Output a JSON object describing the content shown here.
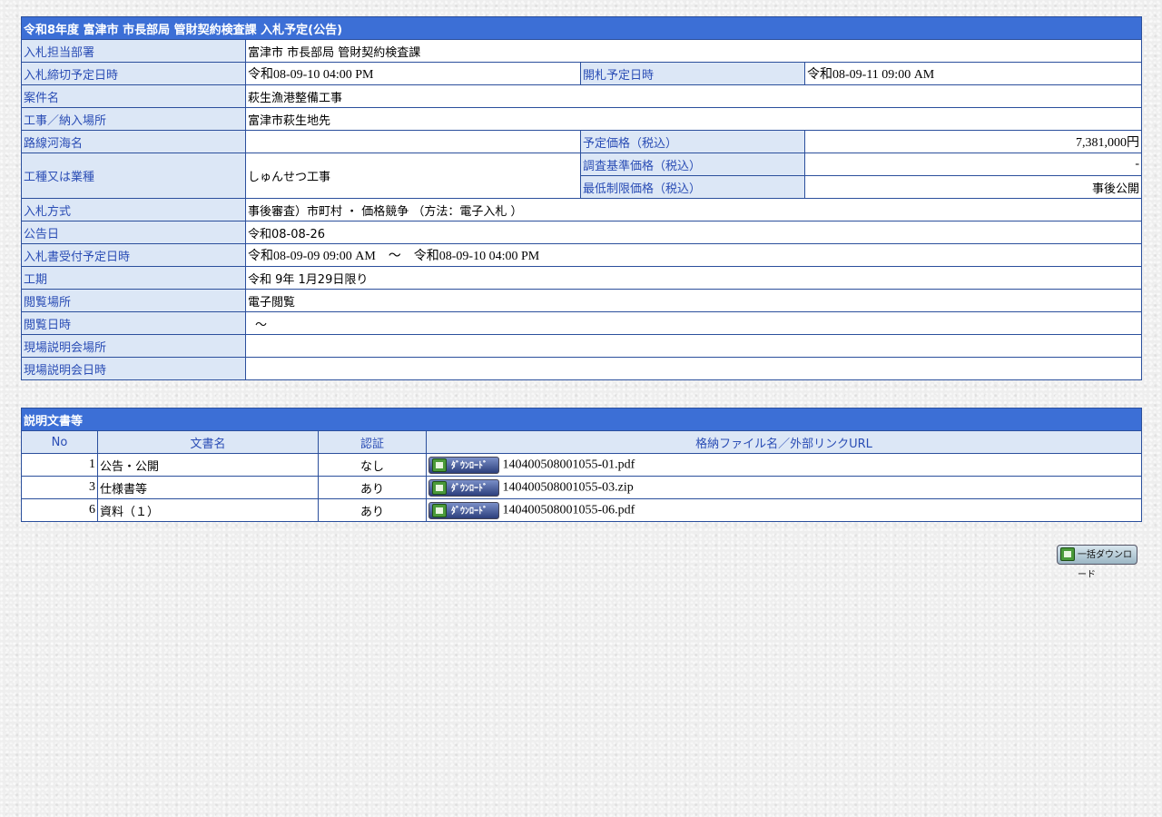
{
  "info": {
    "title": "令和8年度 富津市 市長部局 管財契約検査課 入札予定(公告)",
    "rows": {
      "dept_label": "入札担当部署",
      "dept_value": "富津市 市長部局 管財契約検査課",
      "deadline_label": "入札締切予定日時",
      "deadline_value": "令和08-09-10 04:00 PM",
      "opening_label": "開札予定日時",
      "opening_value": "令和08-09-11 09:00 AM",
      "case_label": "案件名",
      "case_value": "萩生漁港整備工事",
      "place_label": "工事／納入場所",
      "place_value": "富津市萩生地先",
      "route_label": "路線河海名",
      "route_value": "",
      "price_label": "予定価格（税込）",
      "price_value": "7,381,000円",
      "type_label": "工種又は業種",
      "type_value": "しゅんせつ工事",
      "survey_label": "調査基準価格（税込）",
      "survey_value": "-",
      "min_label": "最低制限価格（税込）",
      "min_value": "事後公開",
      "method_label": "入札方式",
      "method_value": "事後審査）市町村 ・ 価格競争 （方法：電子入札 ）",
      "notice_label": "公告日",
      "notice_value": "令和08-08-26",
      "accept_label": "入札書受付予定日時",
      "accept_value": "令和08-09-09 09:00 AM　～　令和08-09-10 04:00 PM",
      "period_label": "工期",
      "period_value": "令和 9年 1月29日限り",
      "view_place_label": "閲覧場所",
      "view_place_value": "電子閲覧",
      "view_date_label": "閲覧日時",
      "view_date_value": "～",
      "site_place_label": "現場説明会場所",
      "site_place_value": "",
      "site_date_label": "現場説明会日時",
      "site_date_value": ""
    }
  },
  "docs": {
    "title": "説明文書等",
    "headers": {
      "no": "No",
      "name": "文書名",
      "auth": "認証",
      "file": "格納ファイル名／外部リンクURL"
    },
    "download_label": "ﾀﾞｳﾝﾛｰﾄﾞ",
    "rows": [
      {
        "no": "1",
        "name": "公告・公開",
        "auth": "なし",
        "file": "140400508001055-01.pdf"
      },
      {
        "no": "3",
        "name": "仕様書等",
        "auth": "あり",
        "file": "140400508001055-03.zip"
      },
      {
        "no": "6",
        "name": "資料（１）",
        "auth": "あり",
        "file": "140400508001055-06.pdf"
      }
    ]
  },
  "bulk_download_label": "一括ダウンロード",
  "icons": {
    "download": "download-icon"
  }
}
